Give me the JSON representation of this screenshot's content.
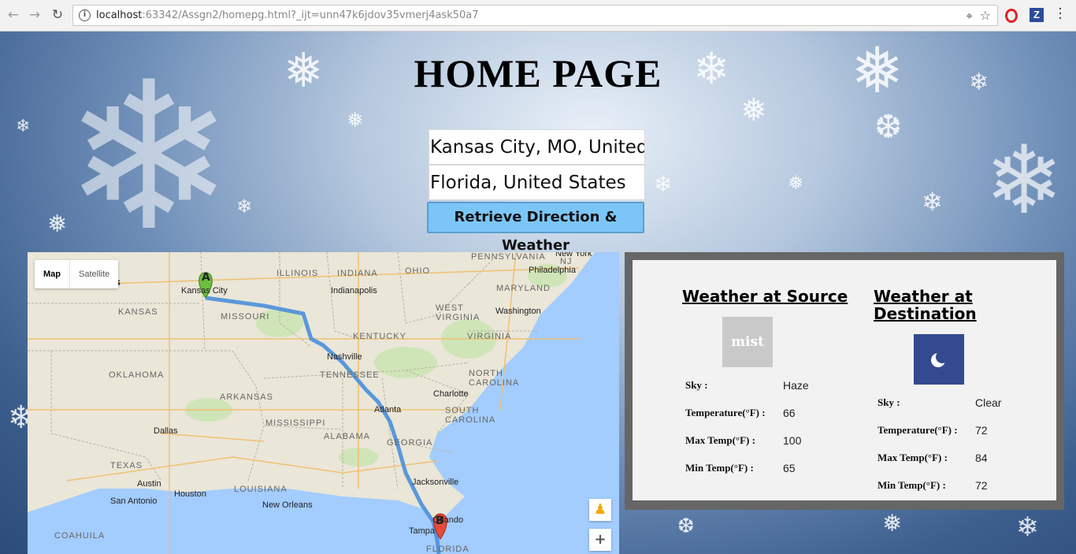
{
  "browser": {
    "url_host": "localhost",
    "url_rest": ":63342/Assgn2/homepg.html?_ijt=unn47k6jdov35vmerj4ask50a7"
  },
  "page": {
    "title": "HOME PAGE",
    "source_value": "Kansas City, MO, United States",
    "destination_value": "Florida, United States",
    "submit_label": "Retrieve Direction & Weather"
  },
  "map": {
    "type_map": "Map",
    "type_satellite": "Satellite",
    "marker_a": "A",
    "marker_b": "B",
    "labels": {
      "pennsylvania": "PENNSYLVANIA",
      "new_york": "New York",
      "nj": "NJ",
      "philadelphia": "Philadelphia",
      "illinois": "ILLINOIS",
      "indiana": "INDIANA",
      "ohio": "OHIO",
      "maryland": "MARYLAND",
      "kansas_city": "Kansas City",
      "indianapolis": "Indianapolis",
      "washington": "Washington",
      "kansas": "KANSAS",
      "missouri": "MISSOURI",
      "west_virginia": "WEST\nVIRGINIA",
      "virginia": "VIRGINIA",
      "kentucky": "KENTUCKY",
      "nashville": "Nashville",
      "oklahoma": "OKLAHOMA",
      "tennessee": "TENNESSEE",
      "north_carolina": "NORTH\nCAROLINA",
      "arkansas": "ARKANSAS",
      "charlotte": "Charlotte",
      "atlanta": "Atlanta",
      "south_carolina": "SOUTH\nCAROLINA",
      "dallas": "Dallas",
      "mississippi": "MISSISSIPPI",
      "alabama": "ALABAMA",
      "georgia": "GEORGIA",
      "texas": "TEXAS",
      "austin": "Austin",
      "houston": "Houston",
      "louisiana": "LOUISIANA",
      "jacksonville": "Jacksonville",
      "san_antonio": "San Antonio",
      "new_orleans": "New Orleans",
      "orlando": "Orlando",
      "tampa": "Tampa",
      "coahuila": "COAHUILA",
      "florida": "FLORIDA",
      "ates": "ates"
    }
  },
  "weather": {
    "source": {
      "title": "Weather at Source",
      "icon_text": "mist",
      "sky_label": "Sky :",
      "sky": "Haze",
      "temp_label": "Temperature(°F) :",
      "temp": "66",
      "max_label": "Max Temp(°F) :",
      "max": "100",
      "min_label": "Min Temp(°F) :",
      "min": "65"
    },
    "destination": {
      "title": "Weather at Destination",
      "icon": "moon-icon",
      "sky_label": "Sky :",
      "sky": "Clear",
      "temp_label": "Temperature(°F) :",
      "temp": "72",
      "max_label": "Max Temp(°F) :",
      "max": "84",
      "min_label": "Min Temp(°F) :",
      "min": "72"
    }
  }
}
